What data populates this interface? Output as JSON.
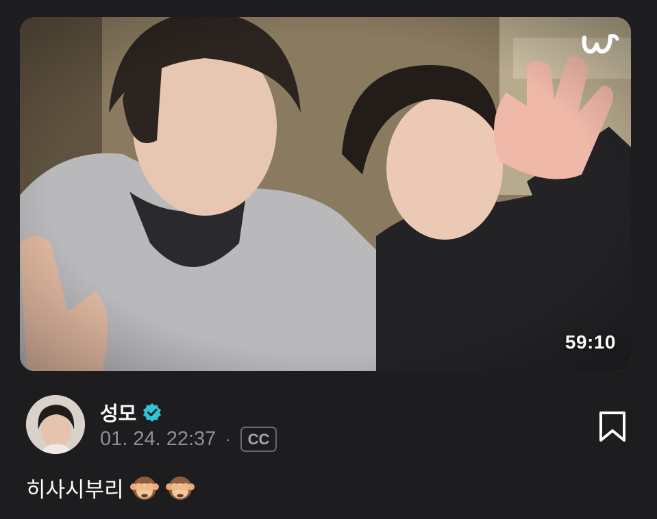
{
  "video": {
    "duration": "59:10",
    "brand_icon": "weverse-logo-icon"
  },
  "post": {
    "author_name": "성모",
    "verified_icon": "verified-badge-icon",
    "timestamp": "01. 24. 22:37",
    "separator": "·",
    "cc_label": "CC",
    "bookmark_icon": "bookmark-icon",
    "caption_text": "히사시부리",
    "caption_emoji": [
      "see-no-evil-monkey-icon",
      "see-no-evil-monkey-icon"
    ]
  },
  "colors": {
    "background": "#1d1d1f",
    "verified": "#2fc4d8",
    "muted_text": "#8e8e93"
  }
}
